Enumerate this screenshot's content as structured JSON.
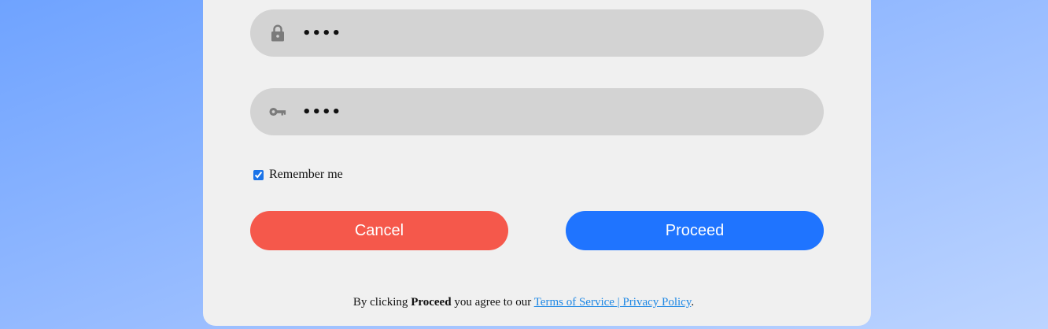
{
  "form": {
    "password_field": {
      "value": "1234",
      "icon": "lock-icon"
    },
    "confirm_field": {
      "value": "1234",
      "icon": "key-icon"
    },
    "remember_me": {
      "label": "Remember me",
      "checked": true
    },
    "buttons": {
      "cancel_label": "Cancel",
      "proceed_label": "Proceed",
      "cancel_color": "#f5584b",
      "proceed_color": "#1f74ff"
    },
    "terms": {
      "prefix": "By clicking",
      "bold_word": "Proceed",
      "middle": "you agree to our",
      "link_text": "Terms of Service | Privacy Policy",
      "suffix": "."
    }
  },
  "colors": {
    "background_start": "#6fa3ff",
    "background_end": "#bcd4ff",
    "card": "#f0f0f0",
    "field": "#d3d3d3",
    "link": "#1e88e5"
  }
}
